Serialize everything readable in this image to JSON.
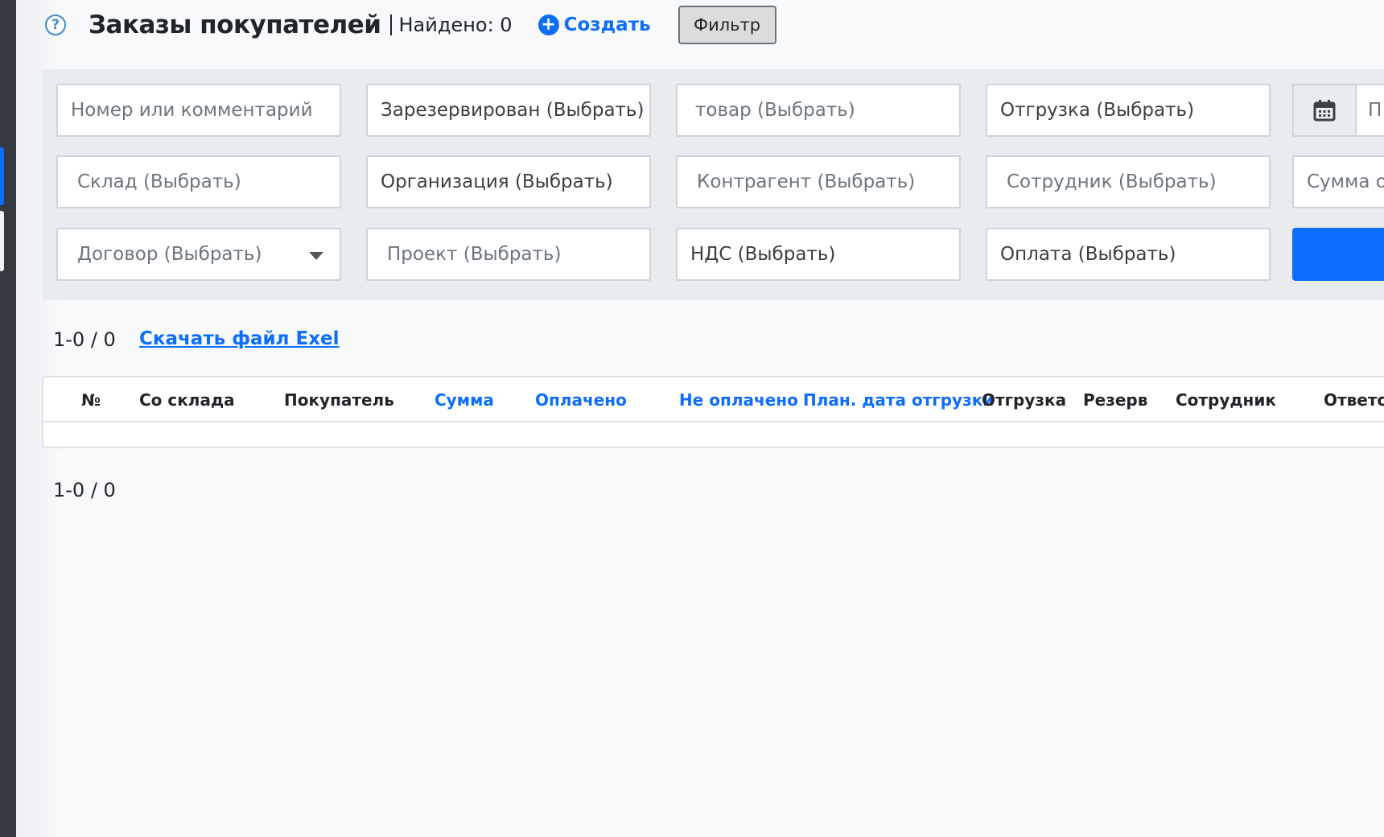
{
  "header": {
    "title": "Заказы покупателей",
    "found": "Найдено: 0",
    "create_label": "Создать",
    "filter_label": "Фильтр"
  },
  "filters": {
    "number_placeholder": "Номер или комментарий",
    "reserved": "Зарезервирован (Выбрать)",
    "product": "товар (Выбрать)",
    "shipment": "Отгрузка (Выбрать)",
    "date_placeholder": "П",
    "warehouse": "Склад (Выбрать)",
    "organization": "Организация (Выбрать)",
    "counterparty": "Контрагент (Выбрать)",
    "employee": "Сотрудник (Выбрать)",
    "sum_from_placeholder": "Сумма от",
    "contract": "Договор (Выбрать)",
    "project": "Проект (Выбрать)",
    "vat": "НДС (Выбрать)",
    "payment": "Оплата (Выбрать)"
  },
  "pagination": {
    "top": "1-0 / 0",
    "bottom": "1-0 / 0"
  },
  "excel_link": "Скачать файл Exel",
  "table": {
    "columns": [
      "№",
      "Со склада",
      "Покупатель",
      "Сумма",
      "Оплачено",
      "Не оплачено",
      "План. дата отгрузки",
      "Отгрузка",
      "Резерв",
      "Сотрудник",
      "Ответст"
    ],
    "rows": []
  },
  "colors": {
    "accent": "#0d6efd",
    "panel": "#e9ecef",
    "rail": "#343a40"
  }
}
